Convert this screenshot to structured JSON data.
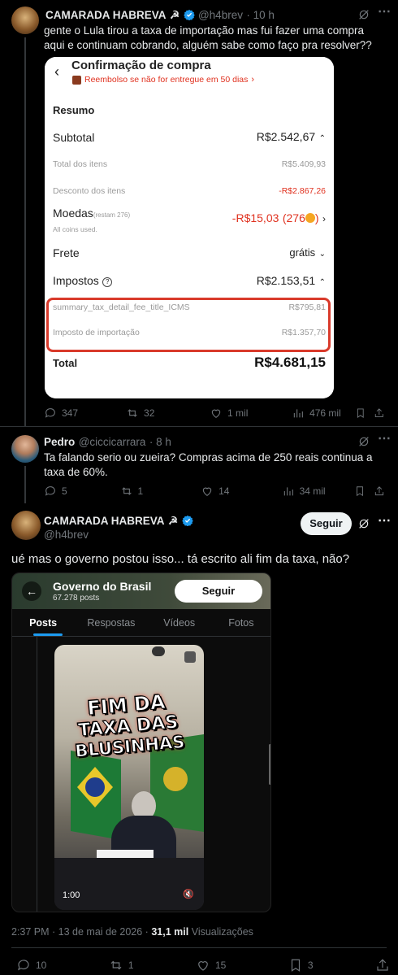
{
  "tweet1": {
    "author": "CAMARADA HABREVA",
    "author_emoji": "☭",
    "handle": "@h4brev",
    "time": "· 10 h",
    "text": "gente o Lula tirou a taxa de importação mas fui fazer uma compra aqui e continuam cobrando, alguém sabe como faço pra resolver??",
    "replies": "347",
    "reposts": "32",
    "likes": "1 mil",
    "views": "476 mil"
  },
  "receipt": {
    "title": "Confirmação de compra",
    "refund_note": "Reembolso se não for entregue em 50 dias",
    "resumo": "Resumo",
    "subtotal_label": "Subtotal",
    "subtotal_value": "R$2.542,67",
    "total_itens_label": "Total dos itens",
    "total_itens_value": "R$5.409,93",
    "desconto_label": "Desconto dos itens",
    "desconto_value": "-R$2.867,26",
    "moedas_label": "Moedas",
    "moedas_rest": "(restam 276)",
    "moedas_sub": "All coins used.",
    "moedas_value": "-R$15,03",
    "moedas_coins": "(276",
    "frete_label": "Frete",
    "frete_value": "grátis",
    "impostos_label": "Impostos",
    "impostos_value": "R$2.153,51",
    "icms_label": "summary_tax_detail_fee_title_ICMS",
    "icms_value": "R$795,81",
    "importacao_label": "Imposto de importação",
    "importacao_value": "R$1.357,70",
    "total_label": "Total",
    "total_value": "R$4.681,15"
  },
  "tweet2": {
    "author": "Pedro",
    "handle": "@ciccicarrara",
    "time": "· 8 h",
    "text": "Ta falando serio ou zueira? Compras acima de 250 reais continua a taxa de 60%.",
    "replies": "5",
    "reposts": "1",
    "likes": "14",
    "views": "34 mil"
  },
  "tweet3": {
    "author": "CAMARADA HABREVA",
    "author_emoji": "☭",
    "handle": "@h4brev",
    "follow_label": "Seguir",
    "text": "ué mas o governo postou isso... tá escrito ali fim da taxa, não?",
    "timestamp": "2:37 PM · 13 de mai de 2026 ·",
    "views_count": "31,1 mil",
    "views_label": "Visualizações",
    "replies": "10",
    "reposts": "1",
    "likes": "15",
    "bookmarks": "3"
  },
  "gov": {
    "profile_name": "Governo do Brasil",
    "posts_count": "67.278 posts",
    "follow_label": "Seguir",
    "tabs": [
      "Posts",
      "Respostas",
      "Vídeos",
      "Fotos"
    ],
    "overlay_line1": "FIM DA",
    "overlay_line2": "TAXA DAS",
    "overlay_line3": "BLUSINHAS",
    "video_time": "1:00"
  },
  "colors": {
    "accent": "#1d9bf0",
    "receipt_red": "#e0311f",
    "highlight_border": "#d93a2b"
  }
}
